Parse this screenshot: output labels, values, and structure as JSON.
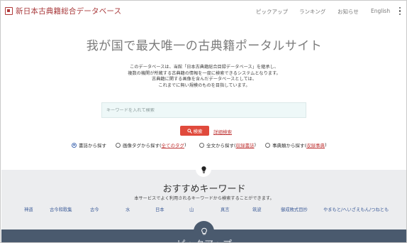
{
  "header": {
    "logo_text": "新日本古典籍総合データベース",
    "nav": [
      "ピックアップ",
      "ランキング",
      "お知らせ",
      "English"
    ]
  },
  "hero": {
    "title": "我が国で最大唯一の古典籍ポータルサイト",
    "description": [
      "このデータベースは、当館「日本古典籍総合目録データベース」を継承し、",
      "複数の機関が所蔵する古典籍の情報を一度に検索できるシステムとなります。",
      "古典籍に関する画像を含んだデータベースとしては、",
      "これまでに無い規模のものを目指しています。"
    ]
  },
  "search": {
    "placeholder": "キーワードを入れて検索",
    "button_label": "検索",
    "advanced_link": "詳細検索"
  },
  "search_modes": [
    {
      "label": "書誌から探す",
      "checked": true
    },
    {
      "label": "画像タグから探す(",
      "link": "全てのタグ",
      "suffix": ")",
      "checked": false
    },
    {
      "label": "全文から探す(",
      "link": "収録書誌",
      "suffix": ")",
      "checked": false
    },
    {
      "label": "事典類から探す(",
      "link": "収録事典",
      "suffix": ")",
      "checked": false
    }
  ],
  "recommended": {
    "title": "おすすめキーワード",
    "subtitle": "本サービスでよく利用されるキーワードから検索することができます。",
    "keywords": [
      "神道",
      "古今和歌集",
      "古今",
      "水",
      "日本",
      "山",
      "真言",
      "筑波",
      "御成敗式目抄",
      "やまもと/へいざえもん/つねとも"
    ]
  },
  "next_section": {
    "title": "ピックアップ"
  },
  "colors": {
    "brand_red": "#a8383a",
    "button_red": "#e04a3c",
    "link_blue": "#3d5c99",
    "section_gray": "#ecedef",
    "dark_band": "#4a5a6e"
  },
  "icons": {
    "logo": "logo-square-icon",
    "menu": "kebab-menu-icon",
    "search": "search-icon",
    "keywords_badge": "lightbulb-icon",
    "pickup_badge": "lightbulb-outline-icon"
  }
}
